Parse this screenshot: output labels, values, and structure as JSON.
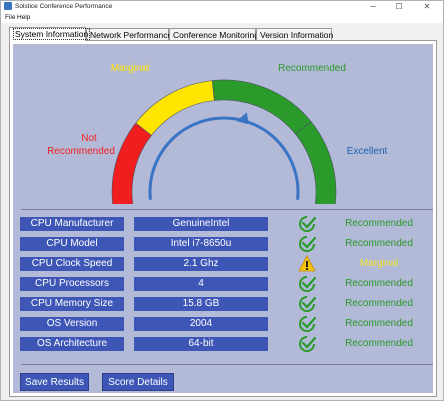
{
  "window": {
    "title": "Solstice Conference Performance",
    "controls": {
      "minimize": "─",
      "maximize": "☐",
      "close": "✕"
    }
  },
  "menu": [
    "File",
    "Help"
  ],
  "tabs": [
    {
      "label": "System Information",
      "active": true
    },
    {
      "label": "Network Performance",
      "active": false
    },
    {
      "label": "Conference Monitoring",
      "active": false
    },
    {
      "label": "Version Information",
      "active": false
    }
  ],
  "gauge": {
    "labels": {
      "not_recommended_line1": "Not",
      "not_recommended_line2": "Recommended",
      "marginal": "Marginal",
      "recommended": "Recommended",
      "excellent": "Excellent"
    },
    "colors": {
      "not_recommended": "#f01e1e",
      "marginal": "#ffe600",
      "recommended": "#2a9a2a",
      "excellent": "#2a9a2a",
      "needle": "#3a74c4"
    }
  },
  "rows": [
    {
      "label": "CPU Manufacturer",
      "value": "GenuineIntel",
      "icon": "check-circle-icon",
      "status": "Recommended",
      "status_color": "#2a9a2a"
    },
    {
      "label": "CPU Model",
      "value": "Intel i7-8650u",
      "icon": "check-circle-icon",
      "status": "Recommended",
      "status_color": "#2a9a2a"
    },
    {
      "label": "CPU Clock Speed",
      "value": "2.1 Ghz",
      "icon": "warning-icon",
      "status": "Marginal",
      "status_color": "#f2e52a"
    },
    {
      "label": "CPU Processors",
      "value": "4",
      "icon": "check-circle-icon",
      "status": "Recommended",
      "status_color": "#2a9a2a"
    },
    {
      "label": "CPU Memory Size",
      "value": "15.8 GB",
      "icon": "check-circle-icon",
      "status": "Recommended",
      "status_color": "#2a9a2a"
    },
    {
      "label": "OS Version",
      "value": "2004",
      "icon": "check-circle-icon",
      "status": "Recommended",
      "status_color": "#2a9a2a"
    },
    {
      "label": "OS Architecture",
      "value": "64-bit",
      "icon": "check-circle-icon",
      "status": "Recommended",
      "status_color": "#2a9a2a"
    }
  ],
  "buttons": {
    "save": "Save Results",
    "score": "Score Details"
  }
}
